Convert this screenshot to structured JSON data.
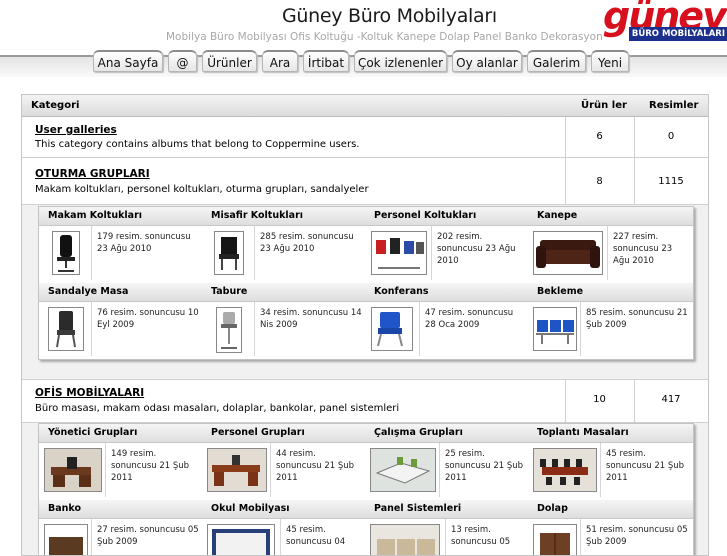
{
  "header": {
    "title": "Güney Büro Mobilyaları",
    "description": "Mobilya Büro Mobilyası Ofis Koltuğu -Koltuk Kanepe Dolap Panel Banko Dekorasyon",
    "logo": {
      "wordmark": "güney",
      "tagline": "BÜRO MOBİLYALARI"
    }
  },
  "nav": {
    "tabs": [
      {
        "label": "Ana Sayfa"
      },
      {
        "label": "@"
      },
      {
        "label": "Ürünler"
      },
      {
        "label": "Ara"
      },
      {
        "label": "İrtibat"
      },
      {
        "label": "Çok izlenenler"
      },
      {
        "label": "Oy alanlar"
      },
      {
        "label": "Galerim"
      },
      {
        "label": "Yeni"
      }
    ]
  },
  "table": {
    "headers": {
      "category": "Kategori",
      "albums": "Ürün ler",
      "pictures": "Resimler"
    },
    "categories": [
      {
        "title": "User galleries",
        "description": "This category contains albums that belong to Coppermine users.",
        "albums": "6",
        "pictures": "0"
      },
      {
        "title": "OTURMA GRUPLARI",
        "description": "Makam koltukları, personel koltukları, oturma grupları, sandalyeler",
        "albums": "8",
        "pictures": "1115",
        "subcats": [
          {
            "name": "Makam Koltukları",
            "info": "179 resim. sonuncusu 23 Ağu 2010"
          },
          {
            "name": "Misafir Koltukları",
            "info": "285 resim. sonuncusu 23 Ağu 2010"
          },
          {
            "name": "Personel Koltukları",
            "info": "202 resim. sonuncusu 23 Ağu 2010"
          },
          {
            "name": "Kanepe",
            "info": "227 resim. sonuncusu 23 Ağu 2010"
          },
          {
            "name": "Sandalye Masa",
            "info": "76 resim. sonuncusu 10 Eyl 2009"
          },
          {
            "name": "Tabure",
            "info": "34 resim. sonuncusu 14 Nis 2009"
          },
          {
            "name": "Konferans",
            "info": "47 resim. sonuncusu 28 Oca 2009"
          },
          {
            "name": "Bekleme",
            "info": "85 resim. sonuncusu 21 Şub 2009"
          }
        ]
      },
      {
        "title": "OFİS MOBİLYALARI",
        "description": "Büro masası, makam odası masaları, dolaplar, bankolar, panel sistemleri",
        "albums": "10",
        "pictures": "417",
        "subcats": [
          {
            "name": "Yönetici Grupları",
            "info": "149 resim. sonuncusu 21 Şub 2011"
          },
          {
            "name": "Personel Grupları",
            "info": "44 resim. sonuncusu 21 Şub 2011"
          },
          {
            "name": "Çalışma Grupları",
            "info": "25 resim. sonuncusu 21 Şub 2011"
          },
          {
            "name": "Toplantı Masaları",
            "info": "45 resim. sonuncusu 21 Şub 2011"
          },
          {
            "name": "Banko",
            "info": "27 resim. sonuncusu 05 Şub 2009"
          },
          {
            "name": "Okul Mobilyası",
            "info": "45 resim. sonuncusu 04"
          },
          {
            "name": "Panel Sistemleri",
            "info": "13 resim. sonuncusu 05"
          },
          {
            "name": "Dolap",
            "info": "51 resim. sonuncusu 05 Şub 2009"
          }
        ]
      }
    ]
  },
  "colors": {
    "accent_red": "#d8101e",
    "logo_blue": "#1c2f8c",
    "header_bg": "#e2e2e2"
  }
}
